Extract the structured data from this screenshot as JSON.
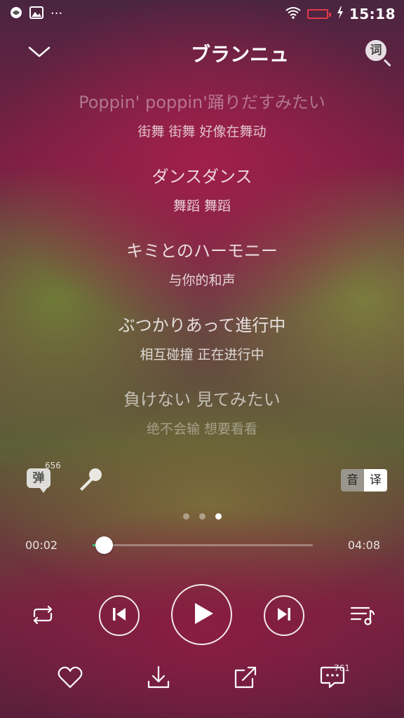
{
  "status_bar": {
    "time": "15:18",
    "icons": [
      "notification-icon",
      "gallery-icon",
      "more-dots-icon",
      "wifi-icon",
      "battery-icon",
      "charging-icon"
    ],
    "more_dots": "···"
  },
  "header": {
    "title": "ブランニュ",
    "lyrics_button_label": "词",
    "back_icon": "chevron-down-icon"
  },
  "lyrics": [
    {
      "main": "Poppin' poppin'踊りだすみたい",
      "translation": "街舞 街舞 好像在舞动"
    },
    {
      "main": "ダンスダンス",
      "translation": "舞蹈 舞蹈"
    },
    {
      "main": "キミとのハーモニー",
      "translation": "与你的和声"
    },
    {
      "main": "ぶつかりあって進行中",
      "translation": "相互碰撞 正在进行中"
    },
    {
      "main": "負けない 見てみたい",
      "translation": "绝不会输 想要看看"
    }
  ],
  "tools": {
    "danmu_label": "弹",
    "danmu_count": "656",
    "toggle": {
      "phonetic_label": "音",
      "translation_label": "译",
      "active": "译"
    }
  },
  "pager": {
    "count": 3,
    "active_index": 2
  },
  "progress": {
    "current": "00:02",
    "total": "04:08",
    "fraction": 0.05
  },
  "controls": {
    "repeat_icon": "repeat-icon",
    "previous_icon": "previous-icon",
    "play_icon": "play-icon",
    "next_icon": "next-icon",
    "playlist_icon": "playlist-icon"
  },
  "bottom_bar": {
    "comment_count": "761",
    "icons": [
      "heart-icon",
      "download-icon",
      "share-icon",
      "comment-icon"
    ]
  },
  "colors": {
    "progress_fill": "#2ecc71",
    "battery_outline": "#e23a4a"
  }
}
